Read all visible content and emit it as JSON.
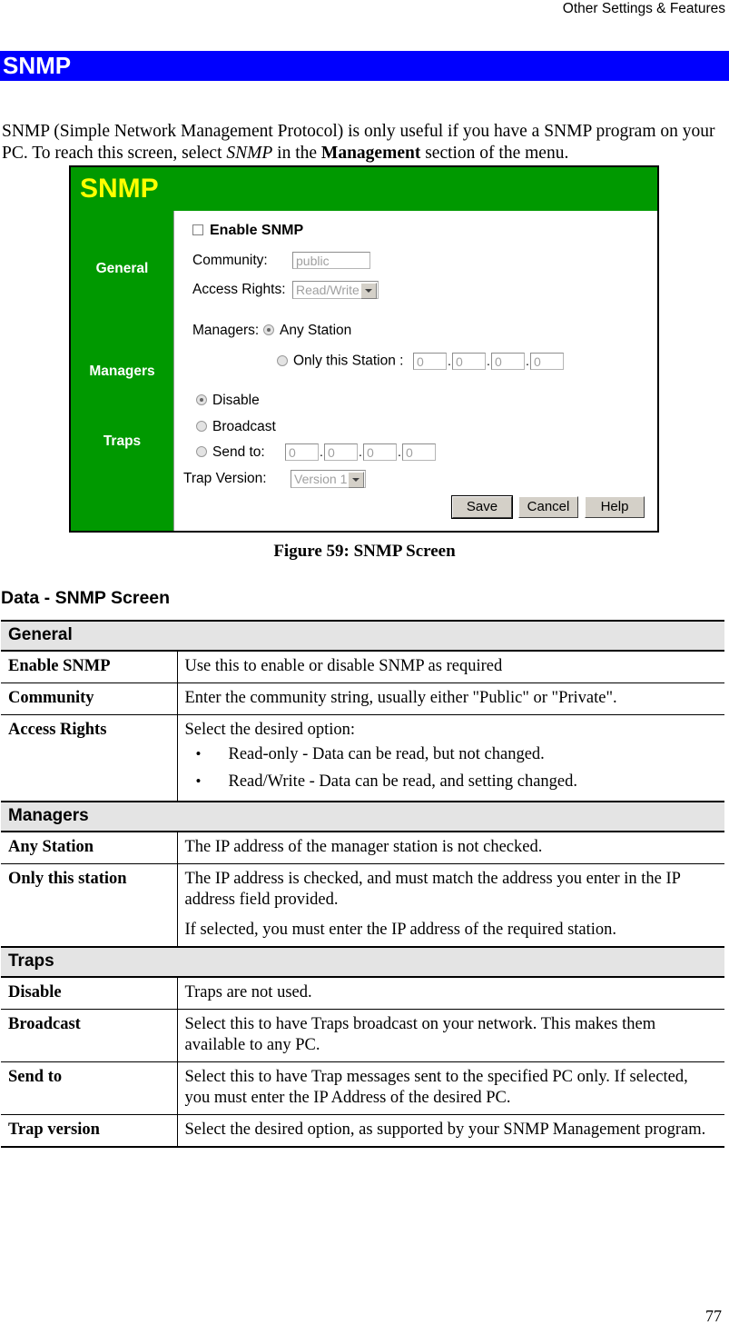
{
  "header": {
    "running_head": "Other Settings & Features"
  },
  "banner": {
    "title": "SNMP",
    "bg_color": "#0000FF",
    "text_color": "#FFFFFF"
  },
  "intro": {
    "part1": "SNMP (Simple Network Management Protocol) is only useful if you have a SNMP program on your PC. To reach this screen, select ",
    "italic": "SNMP",
    "part2": " in the ",
    "bold": "Management",
    "part3": " section of the menu."
  },
  "figure": {
    "screen_title": "SNMP",
    "title_color": "#FFFF00",
    "sidebar_color": "#009900",
    "sidebar": {
      "general": "General",
      "managers": "Managers",
      "traps": "Traps"
    },
    "general": {
      "enable_label": "Enable SNMP",
      "enable_checked": false,
      "community_label": "Community:",
      "community_value": "public",
      "access_rights_label": "Access Rights:",
      "access_rights_value": "Read/Write"
    },
    "managers": {
      "label": "Managers:",
      "any_station": "Any Station",
      "any_station_selected": true,
      "only_this_station": "Only this Station :",
      "only_this_station_selected": false,
      "ip_octets": [
        "0",
        "0",
        "0",
        "0"
      ],
      "separator": "."
    },
    "traps": {
      "disable": "Disable",
      "disable_selected": true,
      "broadcast": "Broadcast",
      "broadcast_selected": false,
      "send_to": "Send to:",
      "send_to_selected": false,
      "send_ip_octets": [
        "0",
        "0",
        "0",
        "0"
      ],
      "trap_version_label": "Trap Version:",
      "trap_version_value": "Version 1"
    },
    "buttons": {
      "save": "Save",
      "cancel": "Cancel",
      "help": "Help"
    }
  },
  "figure_caption": "Figure 59: SNMP Screen",
  "data_heading": "Data - SNMP Screen",
  "table": {
    "groups": [
      {
        "name": "General",
        "rows": [
          {
            "key": "Enable SNMP",
            "text": "Use this to enable or disable SNMP as required"
          },
          {
            "key": "Community",
            "text": "Enter the community string, usually either \"Public\" or \"Private\"."
          },
          {
            "key": "Access Rights",
            "text": "Select the desired option:",
            "bullets": [
              "Read-only - Data can be read, but not changed.",
              "Read/Write - Data can be read, and setting changed."
            ]
          }
        ]
      },
      {
        "name": "Managers",
        "rows": [
          {
            "key": "Any Station",
            "text": "The IP address of the manager station is not checked."
          },
          {
            "key": "Only this station",
            "text": "The IP address is checked, and must match the address you enter in the IP address field provided.",
            "text2": "If selected, you must enter the IP address of the required station."
          }
        ]
      },
      {
        "name": "Traps",
        "rows": [
          {
            "key": "Disable",
            "text": "Traps are not used."
          },
          {
            "key": "Broadcast",
            "text": "Select this to have Traps broadcast on your network. This makes them available to any PC."
          },
          {
            "key": "Send to",
            "text": "Select this to have Trap messages sent to the specified PC only. If selected, you must enter the IP Address of the desired PC."
          },
          {
            "key": "Trap version",
            "text": "Select the desired option, as supported by your SNMP Management program."
          }
        ]
      }
    ]
  },
  "page_number": "77"
}
